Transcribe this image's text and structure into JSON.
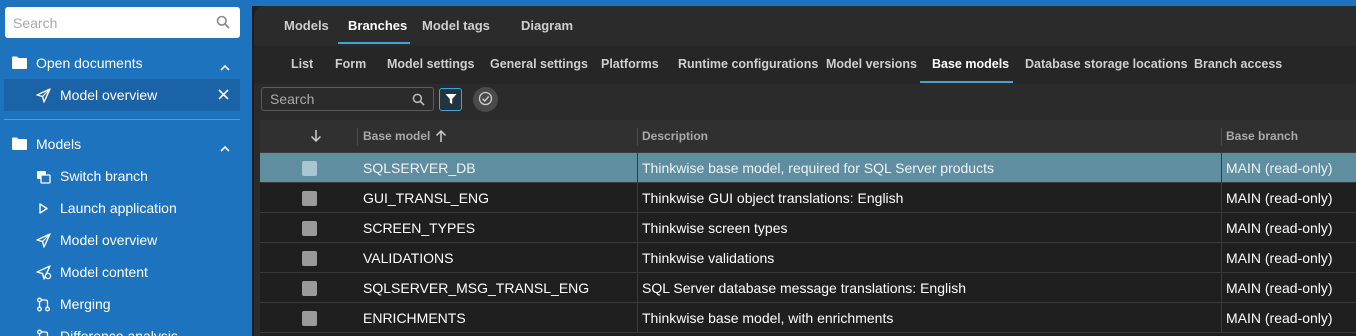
{
  "sidebar": {
    "search_placeholder": "Search",
    "open_documents": {
      "label": "Open documents",
      "items": [
        {
          "label": "Model overview",
          "icon": "send-icon"
        }
      ]
    },
    "models": {
      "label": "Models",
      "items": [
        {
          "label": "Switch branch",
          "icon": "switch-branch-icon"
        },
        {
          "label": "Launch application",
          "icon": "play-icon"
        },
        {
          "label": "Model overview",
          "icon": "send-icon"
        },
        {
          "label": "Model content",
          "icon": "send-gear-icon"
        },
        {
          "label": "Merging",
          "icon": "merge-icon"
        },
        {
          "label": "Difference analysis",
          "icon": "difference-icon"
        }
      ]
    }
  },
  "top_tabs": [
    "Models",
    "Branches",
    "Model tags",
    "Diagram"
  ],
  "top_tabs_active": "Branches",
  "sub_tabs": [
    "List",
    "Form",
    "Model settings",
    "General settings",
    "Platforms",
    "Runtime configurations",
    "Model versions",
    "Base models",
    "Database storage locations",
    "Branch access"
  ],
  "sub_tabs_active": "Base models",
  "toolbar": {
    "search_placeholder": "Search"
  },
  "grid": {
    "columns": [
      "Base model",
      "Description",
      "Base branch"
    ],
    "sorted_column": "Base model",
    "rows": [
      {
        "base_model": "SQLSERVER_DB",
        "description": "Thinkwise base model, required for SQL Server products",
        "base_branch": "MAIN (read-only)",
        "checked": true,
        "selected": true
      },
      {
        "base_model": "GUI_TRANSL_ENG",
        "description": "Thinkwise GUI object translations: English",
        "base_branch": "MAIN (read-only)",
        "checked": true,
        "selected": false
      },
      {
        "base_model": "SCREEN_TYPES",
        "description": "Thinkwise screen types",
        "base_branch": "MAIN (read-only)",
        "checked": true,
        "selected": false
      },
      {
        "base_model": "VALIDATIONS",
        "description": "Thinkwise validations",
        "base_branch": "MAIN (read-only)",
        "checked": true,
        "selected": false
      },
      {
        "base_model": "SQLSERVER_MSG_TRANSL_ENG",
        "description": "SQL Server database message translations: English",
        "base_branch": "MAIN (read-only)",
        "checked": true,
        "selected": false
      },
      {
        "base_model": "ENRICHMENTS",
        "description": "Thinkwise base model, with enrichments",
        "base_branch": "MAIN (read-only)",
        "checked": true,
        "selected": false
      }
    ]
  },
  "colors": {
    "sidebar_bg": "#1e73be",
    "accent": "#3ea7d8",
    "selected_row": "#5e8ea0"
  }
}
